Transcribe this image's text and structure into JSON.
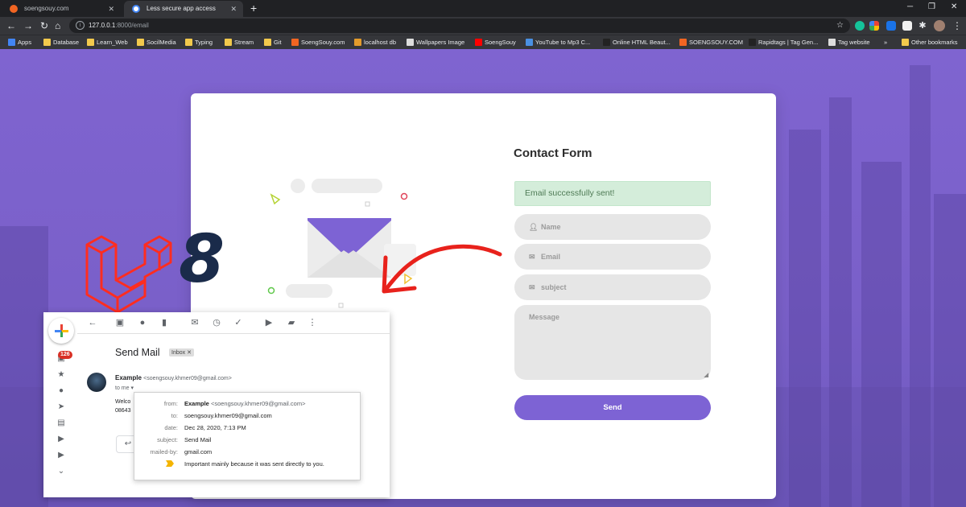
{
  "browser": {
    "tabs": [
      {
        "title": "soengsouy.com",
        "favicon_color": "#f26522",
        "active": false
      },
      {
        "title": "Less secure app access",
        "favicon_color": "#ffffff",
        "active": true
      }
    ],
    "url_host": "127.0.0.1",
    "url_path": ":8000/email",
    "bookmarks": [
      {
        "label": "Apps",
        "icon_color": "#4285f4"
      },
      {
        "label": "Database",
        "icon_color": "#f2c94c"
      },
      {
        "label": "Learn_Web",
        "icon_color": "#f2c94c"
      },
      {
        "label": "SocilMedia",
        "icon_color": "#f2c94c"
      },
      {
        "label": "Typing",
        "icon_color": "#f2c94c"
      },
      {
        "label": "Stream",
        "icon_color": "#f2c94c"
      },
      {
        "label": "Git",
        "icon_color": "#f2c94c"
      },
      {
        "label": "SoengSouy.com",
        "icon_color": "#f26522"
      },
      {
        "label": "localhost db",
        "icon_color": "#e39b2b"
      },
      {
        "label": "Wallpapers Image",
        "icon_color": "#dddddd"
      },
      {
        "label": "SoengSouy",
        "icon_color": "#ff0000"
      },
      {
        "label": "YouTube to Mp3 C...",
        "icon_color": "#4a90e2"
      },
      {
        "label": "Online HTML Beaut...",
        "icon_color": "#222222"
      },
      {
        "label": "SOENGSOUY.COM",
        "icon_color": "#f26522"
      },
      {
        "label": "Rapidtags | Tag Gen...",
        "icon_color": "#222222"
      },
      {
        "label": "Tag website",
        "icon_color": "#dddddd"
      }
    ],
    "bookmarks_overflow": "»",
    "other_bookmarks": "Other bookmarks"
  },
  "contact_form": {
    "title": "Contact Form",
    "success_message": "Email successfully sent!",
    "name_placeholder": "Name",
    "email_placeholder": "Email",
    "subject_placeholder": "subject",
    "message_placeholder": "Message",
    "send_label": "Send"
  },
  "overlay": {
    "version_number": "8"
  },
  "gmail": {
    "unread_count": "126",
    "subject": "Send Mail",
    "label_chip": "Inbox",
    "sender_name": "Example",
    "sender_address": "<soengsouy.khmer09@gmail.com>",
    "to_line": "to me",
    "body_line1": "Welco",
    "body_line2": "08643",
    "details": {
      "from_label": "from:",
      "from_name": "Example",
      "from_address": "<soengsouy.khmer09@gmail.com>",
      "to_label": "to:",
      "to_value": "soengsouy.khmer09@gmail.com",
      "date_label": "date:",
      "date_value": "Dec 28, 2020, 7:13 PM",
      "subject_label": "subject:",
      "subject_value": "Send Mail",
      "mailedby_label": "mailed-by:",
      "mailedby_value": "gmail.com",
      "importance_value": "Important mainly because it was sent directly to you."
    }
  },
  "colors": {
    "accent": "#7d63d4",
    "success_bg": "#d4edda",
    "laravel_red": "#ff2d20",
    "arrow_red": "#e8221c"
  }
}
